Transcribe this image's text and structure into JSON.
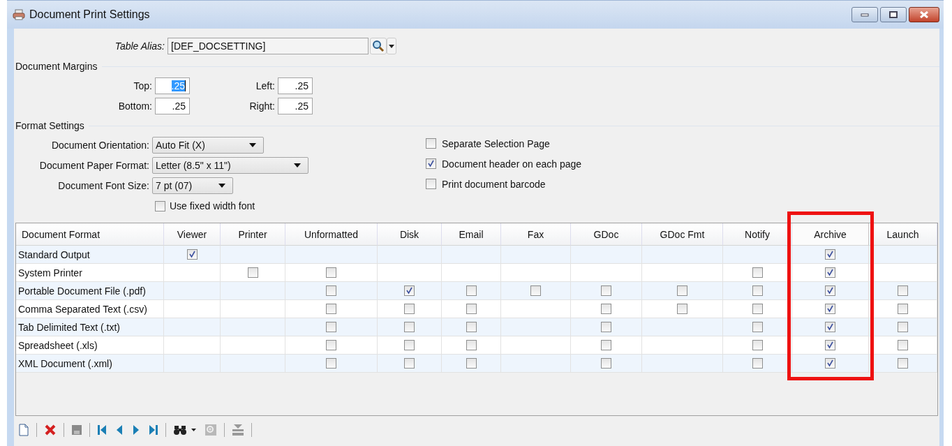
{
  "window": {
    "title": "Document Print Settings"
  },
  "table_alias": {
    "label": "Table Alias:",
    "value": "[DEF_DOCSETTING]"
  },
  "margins": {
    "title": "Document Margins",
    "fields": [
      {
        "label": "Top:",
        "value": ".25",
        "focused": true
      },
      {
        "label": "Left:",
        "value": ".25",
        "focused": false
      },
      {
        "label": "Bottom:",
        "value": ".25",
        "focused": false
      },
      {
        "label": "Right:",
        "value": ".25",
        "focused": false
      }
    ]
  },
  "format_settings": {
    "title": "Format Settings",
    "dropdowns": [
      {
        "label": "Document Orientation:",
        "value": "Auto Fit (X)"
      },
      {
        "label": "Document Paper Format:",
        "value": "Letter (8.5\" x 11\")"
      },
      {
        "label": "Document Font Size:",
        "value": "7 pt (07)"
      }
    ],
    "fixed_width": {
      "label": "Use fixed width font",
      "checked": false
    },
    "options": [
      {
        "label": "Separate Selection Page",
        "checked": false
      },
      {
        "label": "Document header on each page",
        "checked": true
      },
      {
        "label": "Print document barcode",
        "checked": false
      }
    ]
  },
  "table": {
    "columns": [
      {
        "label": "Document Format",
        "highlighted": false
      },
      {
        "label": "Viewer",
        "highlighted": false
      },
      {
        "label": "Printer",
        "highlighted": false
      },
      {
        "label": "Unformatted",
        "highlighted": false
      },
      {
        "label": "Disk",
        "highlighted": false
      },
      {
        "label": "Email",
        "highlighted": false
      },
      {
        "label": "Fax",
        "highlighted": false
      },
      {
        "label": "GDoc",
        "highlighted": false
      },
      {
        "label": "GDoc Fmt",
        "highlighted": false
      },
      {
        "label": "Notify",
        "highlighted": false
      },
      {
        "label": "Archive",
        "highlighted": true
      },
      {
        "label": "Launch",
        "highlighted": false
      }
    ],
    "rows": [
      {
        "label": "Standard Output",
        "cells": [
          {
            "kind": "checkbox",
            "checked": true
          },
          {
            "kind": "blank"
          },
          {
            "kind": "blank"
          },
          {
            "kind": "blank"
          },
          {
            "kind": "blank"
          },
          {
            "kind": "blank"
          },
          {
            "kind": "blank"
          },
          {
            "kind": "blank"
          },
          {
            "kind": "blank"
          },
          {
            "kind": "checkbox",
            "checked": true
          },
          {
            "kind": "blank"
          }
        ]
      },
      {
        "label": "System Printer",
        "cells": [
          {
            "kind": "blank"
          },
          {
            "kind": "checkbox",
            "checked": false
          },
          {
            "kind": "checkbox",
            "checked": false
          },
          {
            "kind": "blank"
          },
          {
            "kind": "blank"
          },
          {
            "kind": "blank"
          },
          {
            "kind": "blank"
          },
          {
            "kind": "blank"
          },
          {
            "kind": "checkbox",
            "checked": false
          },
          {
            "kind": "checkbox",
            "checked": true
          },
          {
            "kind": "blank"
          }
        ]
      },
      {
        "label": "Portable Document File (.pdf)",
        "cells": [
          {
            "kind": "blank"
          },
          {
            "kind": "blank"
          },
          {
            "kind": "checkbox",
            "checked": false
          },
          {
            "kind": "checkbox",
            "checked": true
          },
          {
            "kind": "checkbox",
            "checked": false
          },
          {
            "kind": "checkbox",
            "checked": false
          },
          {
            "kind": "checkbox",
            "checked": false
          },
          {
            "kind": "checkbox",
            "checked": false
          },
          {
            "kind": "checkbox",
            "checked": false
          },
          {
            "kind": "checkbox",
            "checked": true
          },
          {
            "kind": "checkbox",
            "checked": false
          }
        ]
      },
      {
        "label": "Comma Separated Text (.csv)",
        "cells": [
          {
            "kind": "blank"
          },
          {
            "kind": "blank"
          },
          {
            "kind": "checkbox",
            "checked": false
          },
          {
            "kind": "checkbox",
            "checked": false
          },
          {
            "kind": "checkbox",
            "checked": false
          },
          {
            "kind": "blank"
          },
          {
            "kind": "checkbox",
            "checked": false
          },
          {
            "kind": "checkbox",
            "checked": false
          },
          {
            "kind": "checkbox",
            "checked": false
          },
          {
            "kind": "checkbox",
            "checked": true
          },
          {
            "kind": "checkbox",
            "checked": false
          }
        ]
      },
      {
        "label": "Tab Delimited Text (.txt)",
        "cells": [
          {
            "kind": "blank"
          },
          {
            "kind": "blank"
          },
          {
            "kind": "checkbox",
            "checked": false
          },
          {
            "kind": "checkbox",
            "checked": false
          },
          {
            "kind": "checkbox",
            "checked": false
          },
          {
            "kind": "blank"
          },
          {
            "kind": "checkbox",
            "checked": false
          },
          {
            "kind": "blank"
          },
          {
            "kind": "checkbox",
            "checked": false
          },
          {
            "kind": "checkbox",
            "checked": true
          },
          {
            "kind": "checkbox",
            "checked": false
          }
        ]
      },
      {
        "label": "Spreadsheet (.xls)",
        "cells": [
          {
            "kind": "blank"
          },
          {
            "kind": "blank"
          },
          {
            "kind": "checkbox",
            "checked": false
          },
          {
            "kind": "checkbox",
            "checked": false
          },
          {
            "kind": "checkbox",
            "checked": false
          },
          {
            "kind": "blank"
          },
          {
            "kind": "checkbox",
            "checked": false
          },
          {
            "kind": "blank"
          },
          {
            "kind": "checkbox",
            "checked": false
          },
          {
            "kind": "checkbox",
            "checked": true
          },
          {
            "kind": "checkbox",
            "checked": false
          }
        ]
      },
      {
        "label": "XML Document (.xml)",
        "cells": [
          {
            "kind": "blank"
          },
          {
            "kind": "blank"
          },
          {
            "kind": "checkbox",
            "checked": false
          },
          {
            "kind": "checkbox",
            "checked": false
          },
          {
            "kind": "checkbox",
            "checked": false
          },
          {
            "kind": "blank"
          },
          {
            "kind": "checkbox",
            "checked": false
          },
          {
            "kind": "blank"
          },
          {
            "kind": "checkbox",
            "checked": false
          },
          {
            "kind": "checkbox",
            "checked": true
          },
          {
            "kind": "checkbox",
            "checked": false
          }
        ]
      }
    ]
  }
}
